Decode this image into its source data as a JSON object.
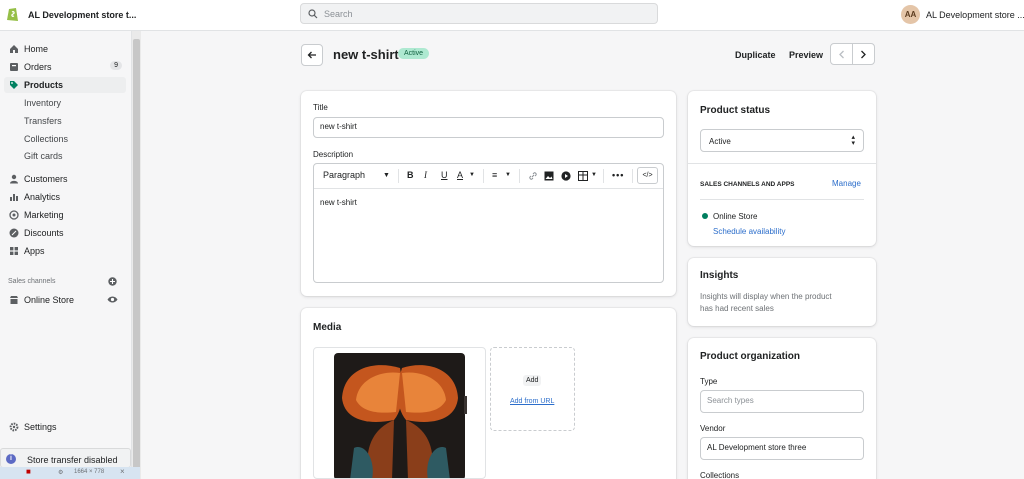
{
  "topbar": {
    "store_name": "AL Development store t...",
    "search_placeholder": "Search",
    "avatar_initials": "AA",
    "user_store": "AL Development store ..."
  },
  "sidebar": {
    "items": [
      {
        "label": "Home",
        "icon": "home-icon"
      },
      {
        "label": "Orders",
        "icon": "orders-icon",
        "badge": "9"
      },
      {
        "label": "Products",
        "icon": "tag-icon",
        "active": true
      },
      {
        "label": "Customers",
        "icon": "person-icon"
      },
      {
        "label": "Analytics",
        "icon": "bar-chart-icon"
      },
      {
        "label": "Marketing",
        "icon": "target-icon"
      },
      {
        "label": "Discounts",
        "icon": "discount-icon"
      },
      {
        "label": "Apps",
        "icon": "apps-icon"
      }
    ],
    "product_subitems": [
      "Inventory",
      "Transfers",
      "Collections",
      "Gift cards"
    ],
    "sales_channels_label": "Sales channels",
    "online_store": "Online Store",
    "settings": "Settings",
    "toast": "Store transfer disabled",
    "devbar_size": "1664 × 778"
  },
  "header": {
    "title": "new t-shirt",
    "status": "Active",
    "duplicate": "Duplicate",
    "preview": "Preview"
  },
  "details": {
    "title_label": "Title",
    "title_value": "new t-shirt",
    "description_label": "Description",
    "paragraph": "Paragraph",
    "body": "new t-shirt"
  },
  "media": {
    "title": "Media",
    "add": "Add",
    "add_from_url": "Add from URL"
  },
  "product_status": {
    "title": "Product status",
    "value": "Active",
    "channels_label": "SALES CHANNELS AND APPS",
    "manage": "Manage",
    "channel": "Online Store",
    "schedule": "Schedule availability"
  },
  "insights": {
    "title": "Insights",
    "text_line1": "Insights will display when the product",
    "text_line2": "has had recent sales"
  },
  "organization": {
    "title": "Product organization",
    "type_label": "Type",
    "type_placeholder": "Search types",
    "vendor_label": "Vendor",
    "vendor_value": "AL Development store three",
    "collections_label": "Collections"
  },
  "colors": {
    "accent": "#2c6ecb",
    "active_badge_bg": "#aee9d1",
    "online_dot": "#007f5f"
  }
}
